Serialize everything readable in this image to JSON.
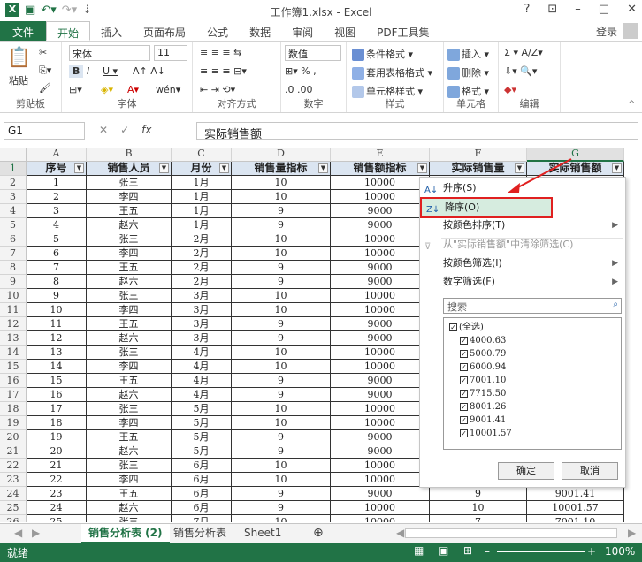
{
  "window": {
    "title": "工作簿1.xlsx - Excel",
    "help": "?",
    "login": "登录"
  },
  "tabs": [
    {
      "label": "文件"
    },
    {
      "label": "开始"
    },
    {
      "label": "插入"
    },
    {
      "label": "页面布局"
    },
    {
      "label": "公式"
    },
    {
      "label": "数据"
    },
    {
      "label": "审阅"
    },
    {
      "label": "视图"
    },
    {
      "label": "PDF工具集"
    }
  ],
  "ribbon": {
    "clipboard": {
      "paste": "粘贴",
      "label": "剪贴板"
    },
    "font": {
      "name": "宋体",
      "size": "11",
      "label": "字体"
    },
    "align": {
      "label": "对齐方式"
    },
    "number": {
      "format": "数值",
      "label": "数字"
    },
    "styles": {
      "cond": "条件格式",
      "table": "套用表格格式",
      "cell": "单元格样式",
      "label": "样式"
    },
    "cells": {
      "insert": "插入",
      "delete": "删除",
      "format": "格式",
      "label": "单元格"
    },
    "edit": {
      "label": "编辑"
    }
  },
  "formula": {
    "namebox": "G1",
    "fx": "fx",
    "value": "实际销售额"
  },
  "columns": [
    "A",
    "B",
    "C",
    "D",
    "E",
    "F",
    "G"
  ],
  "headers": [
    "序号",
    "销售人员",
    "月份",
    "销售量指标",
    "销售额指标",
    "实际销售量",
    "实际销售额"
  ],
  "rows": [
    [
      "1",
      "张三",
      "1月",
      "10",
      "10000"
    ],
    [
      "2",
      "李四",
      "1月",
      "10",
      "10000"
    ],
    [
      "3",
      "王五",
      "1月",
      "9",
      "9000"
    ],
    [
      "4",
      "赵六",
      "1月",
      "9",
      "9000"
    ],
    [
      "5",
      "张三",
      "2月",
      "10",
      "10000"
    ],
    [
      "6",
      "李四",
      "2月",
      "10",
      "10000"
    ],
    [
      "7",
      "王五",
      "2月",
      "9",
      "9000"
    ],
    [
      "8",
      "赵六",
      "2月",
      "9",
      "9000"
    ],
    [
      "9",
      "张三",
      "3月",
      "10",
      "10000"
    ],
    [
      "10",
      "李四",
      "3月",
      "10",
      "10000"
    ],
    [
      "11",
      "王五",
      "3月",
      "9",
      "9000"
    ],
    [
      "12",
      "赵六",
      "3月",
      "9",
      "9000"
    ],
    [
      "13",
      "张三",
      "4月",
      "10",
      "10000"
    ],
    [
      "14",
      "李四",
      "4月",
      "10",
      "10000"
    ],
    [
      "15",
      "王五",
      "4月",
      "9",
      "9000"
    ],
    [
      "16",
      "赵六",
      "4月",
      "9",
      "9000"
    ],
    [
      "17",
      "张三",
      "5月",
      "10",
      "10000"
    ],
    [
      "18",
      "李四",
      "5月",
      "10",
      "10000"
    ],
    [
      "19",
      "王五",
      "5月",
      "9",
      "9000"
    ],
    [
      "20",
      "赵六",
      "5月",
      "9",
      "9000"
    ],
    [
      "21",
      "张三",
      "6月",
      "10",
      "10000"
    ],
    [
      "22",
      "李四",
      "6月",
      "10",
      "10000"
    ],
    [
      "23",
      "王五",
      "6月",
      "9",
      "9000",
      "9",
      "9001.41"
    ],
    [
      "24",
      "赵六",
      "6月",
      "9",
      "10000",
      "10",
      "10001.57"
    ],
    [
      "25",
      "张三",
      "7月",
      "10",
      "10000",
      "7",
      "7001.10"
    ]
  ],
  "row_numbers": [
    "1",
    "2",
    "3",
    "4",
    "5",
    "6",
    "7",
    "8",
    "9",
    "10",
    "11",
    "12",
    "13",
    "14",
    "15",
    "16",
    "17",
    "18",
    "19",
    "20",
    "21",
    "22",
    "23",
    "24",
    "25",
    "26"
  ],
  "dropdown": {
    "sort_asc": "升序(S)",
    "sort_desc": "降序(O)",
    "sort_color": "按颜色排序(T)",
    "clear": "从\"实际销售额\"中清除筛选(C)",
    "filter_color": "按颜色筛选(I)",
    "number_filter": "数字筛选(F)",
    "search_placeholder": "搜索",
    "items": [
      "(全选)",
      "4000.63",
      "5000.79",
      "6000.94",
      "7001.10",
      "7715.50",
      "8001.26",
      "9001.41",
      "10001.57"
    ],
    "ok": "确定",
    "cancel": "取消"
  },
  "sheets": [
    "销售分析表 (2)",
    "销售分析表",
    "Sheet1"
  ],
  "status": {
    "ready": "就绪",
    "zoom": "100%"
  },
  "colors": {
    "excel_green": "#217346",
    "header_fill": "#dbe5f1",
    "highlight": "#e02020"
  }
}
